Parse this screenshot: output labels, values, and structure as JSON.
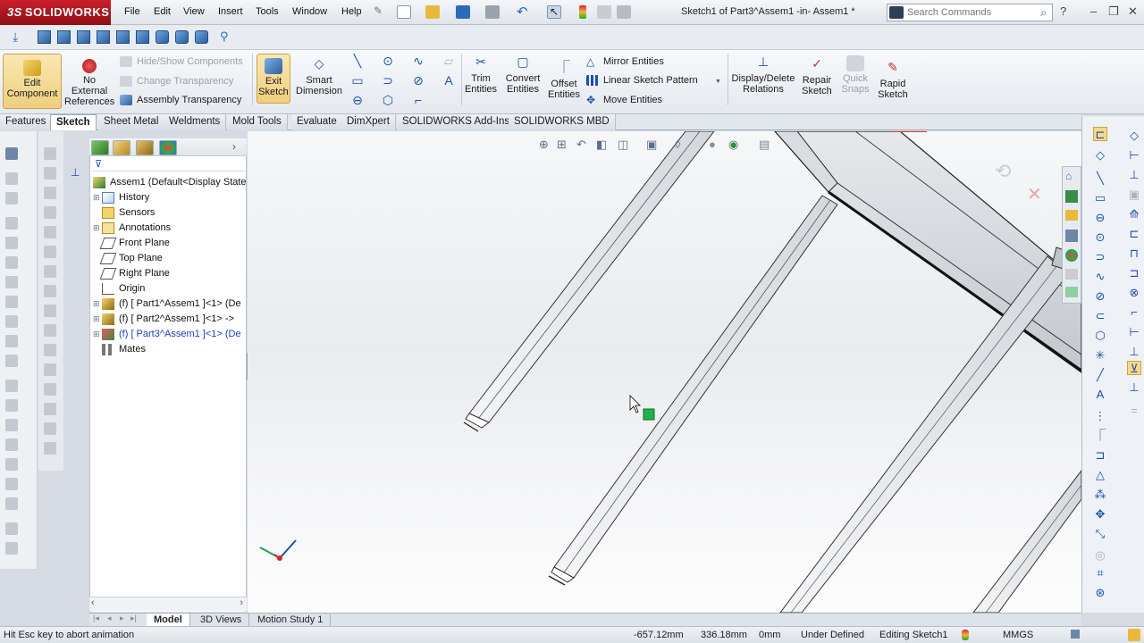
{
  "app": {
    "logo_text": "SOLIDWORKS",
    "logo_mark": "3S"
  },
  "menu": [
    "File",
    "Edit",
    "View",
    "Insert",
    "Tools",
    "Window",
    "Help"
  ],
  "document_title": "Sketch1 of Part3^Assem1 -in- Assem1 *",
  "search": {
    "placeholder": "Search Commands"
  },
  "command_manager": {
    "edit_component": [
      "Edit",
      "Component"
    ],
    "no_external_refs": [
      "No",
      "External",
      "References"
    ],
    "hide_show_components": "Hide/Show Components",
    "change_transparency": "Change Transparency",
    "assembly_transparency": "Assembly Transparency",
    "exit_sketch": [
      "Exit",
      "Sketch"
    ],
    "smart_dimension": [
      "Smart",
      "Dimension"
    ],
    "trim_entities": [
      "Trim",
      "Entities"
    ],
    "convert_entities": [
      "Convert",
      "Entities"
    ],
    "offset_entities": [
      "Offset",
      "Entities"
    ],
    "mirror_entities": "Mirror Entities",
    "linear_sketch_pattern": "Linear Sketch Pattern",
    "move_entities": "Move Entities",
    "display_delete_relations": [
      "Display/Delete",
      "Relations"
    ],
    "repair_sketch": [
      "Repair",
      "Sketch"
    ],
    "quick_snaps": [
      "Quick",
      "Snaps"
    ],
    "rapid_sketch": [
      "Rapid",
      "Sketch"
    ]
  },
  "tabs": [
    "Features",
    "Sketch",
    "Sheet Metal",
    "Weldments",
    "Mold Tools",
    "Evaluate",
    "DimXpert",
    "SOLIDWORKS Add-Ins",
    "SOLIDWORKS MBD"
  ],
  "active_tab": "Sketch",
  "tree": {
    "root": "Assem1  (Default<Display State",
    "items": [
      {
        "label": "History",
        "icon": "history-icon",
        "expandable": true
      },
      {
        "label": "Sensors",
        "icon": "sensors-icon",
        "expandable": false
      },
      {
        "label": "Annotations",
        "icon": "annotations-icon",
        "expandable": true
      },
      {
        "label": "Front Plane",
        "icon": "plane-icon",
        "expandable": false
      },
      {
        "label": "Top Plane",
        "icon": "plane-icon",
        "expandable": false
      },
      {
        "label": "Right Plane",
        "icon": "plane-icon",
        "expandable": false
      },
      {
        "label": "Origin",
        "icon": "origin-icon",
        "expandable": false
      },
      {
        "label": "(f) [ Part1^Assem1 ]<1> (De",
        "icon": "part-icon",
        "expandable": true
      },
      {
        "label": "(f) [ Part2^Assem1 ]<1> ->",
        "icon": "part-icon",
        "expandable": true
      },
      {
        "label": "(f) [ Part3^Assem1 ]<1> (De",
        "icon": "part-edit-icon",
        "expandable": true,
        "highlight": true
      },
      {
        "label": "Mates",
        "icon": "mates-icon",
        "expandable": false
      }
    ]
  },
  "bottom_tabs": [
    "Model",
    "3D Views",
    "Motion Study 1"
  ],
  "active_bottom_tab": "Model",
  "status": {
    "message": "Hit Esc key to abort animation",
    "x": "-657.12mm",
    "y": "336.18mm",
    "z": "0mm",
    "definition": "Under Defined",
    "editing": "Editing Sketch1",
    "units": "MMGS"
  },
  "colors": {
    "accent_red": "#c9202a",
    "sketch_blue": "#1e4fa8",
    "highlight_blue": "#1f3fb5",
    "pressed_gold": "#efcf7d",
    "point_green": "#22b14c"
  }
}
